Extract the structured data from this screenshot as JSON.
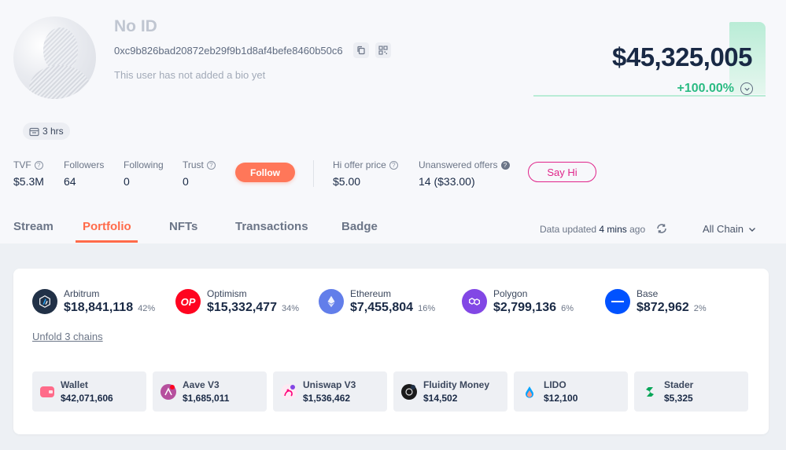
{
  "profile": {
    "name": "No ID",
    "address": "0xc9b826bad20872eb29f9b1d8af4befe8460b50c6",
    "bio": "This user has not added a bio yet",
    "age": "3 hrs"
  },
  "net_worth": {
    "value": "$45,325,005",
    "change": "+100.00%"
  },
  "stats": {
    "tvf_label": "TVF",
    "tvf_value": "$5.3M",
    "followers_label": "Followers",
    "followers_value": "64",
    "following_label": "Following",
    "following_value": "0",
    "trust_label": "Trust",
    "trust_value": "0",
    "follow_button": "Follow",
    "hi_offer_label": "Hi offer price",
    "hi_offer_value": "$5.00",
    "unanswered_label": "Unanswered offers",
    "unanswered_value": "14 ($33.00)",
    "say_hi_button": "Say Hi"
  },
  "tabs": [
    "Stream",
    "Portfolio",
    "NFTs",
    "Transactions",
    "Badge"
  ],
  "active_tab": "Portfolio",
  "data_updated": {
    "prefix": "Data updated",
    "time": "4 mins",
    "suffix": "ago"
  },
  "chain_filter": "All Chain",
  "chains": [
    {
      "name": "Arbitrum",
      "value": "$18,841,118",
      "pct": "42%",
      "color": "#213147"
    },
    {
      "name": "Optimism",
      "value": "$15,332,477",
      "pct": "34%",
      "color": "#ff0420"
    },
    {
      "name": "Ethereum",
      "value": "$7,455,804",
      "pct": "16%",
      "color": "#627eea"
    },
    {
      "name": "Polygon",
      "value": "$2,799,136",
      "pct": "6%",
      "color": "#8247e5"
    },
    {
      "name": "Base",
      "value": "$872,962",
      "pct": "2%",
      "color": "#0052ff"
    }
  ],
  "unfold_label": "Unfold 3 chains",
  "protocols": [
    {
      "name": "Wallet",
      "value": "$42,071,606",
      "color": "#ff6b8a"
    },
    {
      "name": "Aave V3",
      "value": "$1,685,011",
      "color": "#b6509e"
    },
    {
      "name": "Uniswap V3",
      "value": "$1,536,462",
      "color": "#ff007a"
    },
    {
      "name": "Fluidity Money",
      "value": "$14,502",
      "color": "#1a1a1a"
    },
    {
      "name": "LIDO",
      "value": "$12,100",
      "color": "#00a3ff"
    },
    {
      "name": "Stader",
      "value": "$5,325",
      "color": "#07a658"
    }
  ],
  "icons": {
    "optimism_text": "OP"
  }
}
